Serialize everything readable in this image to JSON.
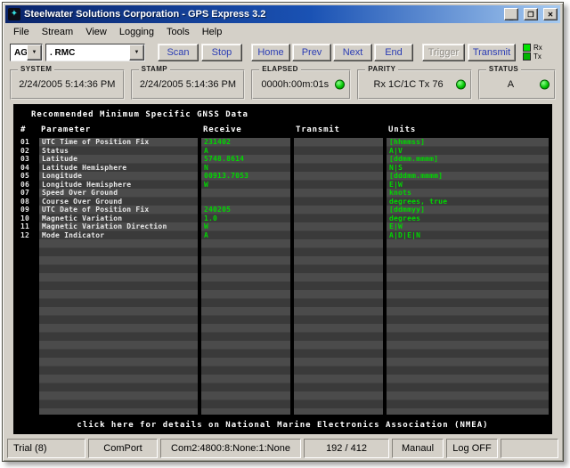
{
  "window": {
    "title": "Steelwater Solutions Corporation - GPS Express 3.2",
    "icon_glyph": "✦",
    "minimize_glyph": "_",
    "maximize_glyph": "❐",
    "close_glyph": "✕"
  },
  "menu": {
    "items": [
      "File",
      "Stream",
      "View",
      "Logging",
      "Tools",
      "Help"
    ]
  },
  "toolbar": {
    "channel_combo": {
      "value": "AG"
    },
    "sentence_combo": {
      "value": ". RMC"
    },
    "dropdown_glyph": "▼",
    "buttons": {
      "scan": "Scan",
      "stop": "Stop",
      "home": "Home",
      "prev": "Prev",
      "next": "Next",
      "end": "End",
      "trigger": "Trigger",
      "transmit": "Transmit"
    },
    "legend": {
      "rx": "Rx",
      "tx": "Tx"
    }
  },
  "panels": {
    "system": {
      "label": "SYSTEM",
      "value": "2/24/2005 5:14:36 PM"
    },
    "stamp": {
      "label": "STAMP",
      "value": "2/24/2005 5:14:36 PM"
    },
    "elapsed": {
      "label": "ELAPSED",
      "value": "0000h:00m:01s"
    },
    "parity": {
      "label": "PARITY",
      "value": "Rx 1C/1C  Tx 76"
    },
    "status": {
      "label": "STATUS",
      "value": "A"
    }
  },
  "main": {
    "title": "Recommended Minimum Specific GNSS Data",
    "headers": {
      "num": "#",
      "parameter": "Parameter",
      "receive": "Receive",
      "transmit": "Transmit",
      "units": "Units"
    },
    "rows": [
      {
        "num": "01",
        "parameter": "UTC Time of Position Fix",
        "receive": "231402",
        "transmit": "",
        "units": "[hhmmss]"
      },
      {
        "num": "02",
        "parameter": "Status",
        "receive": "A",
        "transmit": "",
        "units": "A|V"
      },
      {
        "num": "03",
        "parameter": "Latitude",
        "receive": "5748.8614",
        "transmit": "",
        "units": "[ddmm.mmmm]"
      },
      {
        "num": "04",
        "parameter": "Latitude Hemisphere",
        "receive": "N",
        "transmit": "",
        "units": "N|S"
      },
      {
        "num": "05",
        "parameter": "Longitude",
        "receive": "00913.7053",
        "transmit": "",
        "units": "[dddmm.mmmm]"
      },
      {
        "num": "06",
        "parameter": "Longitude Hemisphere",
        "receive": "W",
        "transmit": "",
        "units": "E|W"
      },
      {
        "num": "07",
        "parameter": "Speed Over Ground",
        "receive": "",
        "transmit": "",
        "units": "knots"
      },
      {
        "num": "08",
        "parameter": "Course Over Ground",
        "receive": "",
        "transmit": "",
        "units": "degrees, true"
      },
      {
        "num": "09",
        "parameter": "UTC Date of Position Fix",
        "receive": "240205",
        "transmit": "",
        "units": "[ddmmyy]"
      },
      {
        "num": "10",
        "parameter": "Magnetic Variation",
        "receive": "1.0",
        "transmit": "",
        "units": "degrees"
      },
      {
        "num": "11",
        "parameter": "Magnetic Variation Direction",
        "receive": "W",
        "transmit": "",
        "units": "E|W"
      },
      {
        "num": "12",
        "parameter": "Mode Indicator",
        "receive": "A",
        "transmit": "",
        "units": "A|D|E|N"
      }
    ],
    "footer": "click here for details on National Marine Electronics Association (NMEA)"
  },
  "statusbar": {
    "cells": [
      "Trial (8)",
      "ComPort",
      "Com2:4800:8:None:1:None",
      "192 / 412",
      "Manaul",
      "Log OFF"
    ]
  },
  "colors": {
    "chrome": "#d4d0c8",
    "title_gradient_start": "#0a246a",
    "title_gradient_end": "#a6caf0",
    "data_green": "#00d800",
    "button_text_blue": "#2a3cb4",
    "led_green": "#00c400"
  }
}
